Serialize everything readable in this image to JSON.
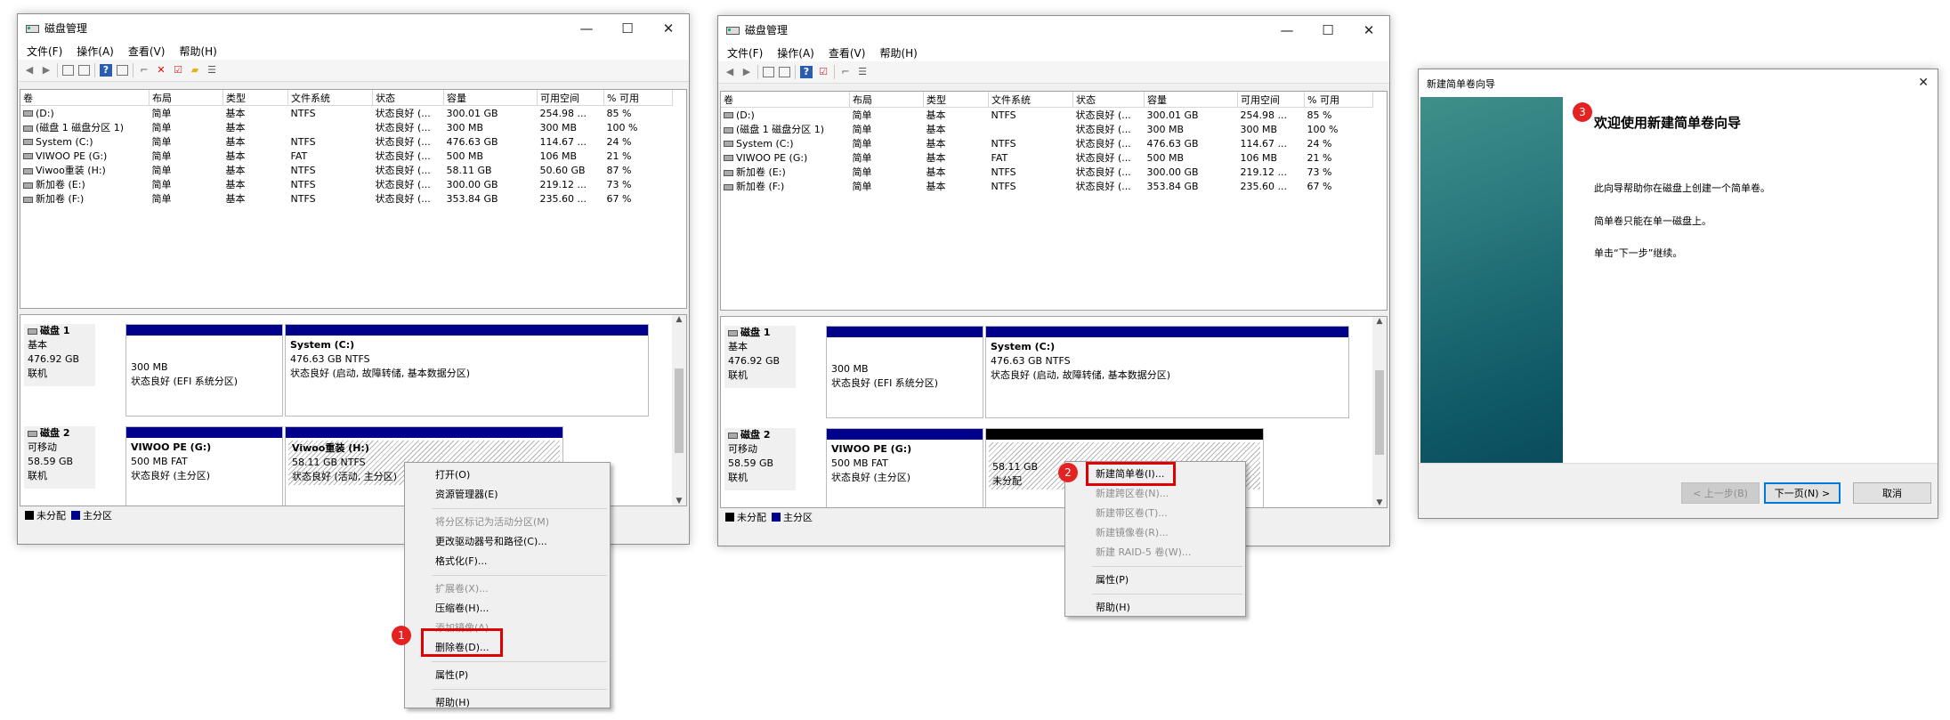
{
  "app": {
    "title": "磁盘管理",
    "menu": [
      "文件(F)",
      "操作(A)",
      "查看(V)",
      "帮助(H)"
    ],
    "window_buttons": {
      "minimize": "—",
      "maximize": "☐",
      "close": "✕"
    }
  },
  "columns": [
    "卷",
    "布局",
    "类型",
    "文件系统",
    "状态",
    "容量",
    "可用空间",
    "% 可用"
  ],
  "volumes_left": [
    [
      "(D:)",
      "简单",
      "基本",
      "NTFS",
      "状态良好 (...",
      "300.01 GB",
      "254.98 ...",
      "85 %"
    ],
    [
      "(磁盘 1 磁盘分区 1)",
      "简单",
      "基本",
      "",
      "状态良好 (...",
      "300 MB",
      "300 MB",
      "100 %"
    ],
    [
      "System (C:)",
      "简单",
      "基本",
      "NTFS",
      "状态良好 (...",
      "476.63 GB",
      "114.67 ...",
      "24 %"
    ],
    [
      "VIWOO PE (G:)",
      "简单",
      "基本",
      "FAT",
      "状态良好 (...",
      "500 MB",
      "106 MB",
      "21 %"
    ],
    [
      "Viwoo重装 (H:)",
      "简单",
      "基本",
      "NTFS",
      "状态良好 (...",
      "58.11 GB",
      "50.60 GB",
      "87 %"
    ],
    [
      "新加卷 (E:)",
      "简单",
      "基本",
      "NTFS",
      "状态良好 (...",
      "300.00 GB",
      "219.12 ...",
      "73 %"
    ],
    [
      "新加卷 (F:)",
      "简单",
      "基本",
      "NTFS",
      "状态良好 (...",
      "353.84 GB",
      "235.60 ...",
      "67 %"
    ]
  ],
  "volumes_right": [
    [
      "(D:)",
      "简单",
      "基本",
      "NTFS",
      "状态良好 (...",
      "300.01 GB",
      "254.98 ...",
      "85 %"
    ],
    [
      "(磁盘 1 磁盘分区 1)",
      "简单",
      "基本",
      "",
      "状态良好 (...",
      "300 MB",
      "300 MB",
      "100 %"
    ],
    [
      "System (C:)",
      "简单",
      "基本",
      "NTFS",
      "状态良好 (...",
      "476.63 GB",
      "114.67 ...",
      "24 %"
    ],
    [
      "VIWOO PE (G:)",
      "简单",
      "基本",
      "FAT",
      "状态良好 (...",
      "500 MB",
      "106 MB",
      "21 %"
    ],
    [
      "新加卷 (E:)",
      "简单",
      "基本",
      "NTFS",
      "状态良好 (...",
      "300.00 GB",
      "219.12 ...",
      "73 %"
    ],
    [
      "新加卷 (F:)",
      "简单",
      "基本",
      "NTFS",
      "状态良好 (...",
      "353.84 GB",
      "235.60 ...",
      "67 %"
    ]
  ],
  "disk1": {
    "name": "磁盘 1",
    "type": "基本",
    "size": "476.92 GB",
    "status": "联机",
    "p1": {
      "size": "300 MB",
      "status": "状态良好 (EFI 系统分区)"
    },
    "p2": {
      "name": "System  (C:)",
      "size": "476.63 GB NTFS",
      "status": "状态良好 (启动, 故障转储, 基本数据分区)"
    }
  },
  "disk2_left": {
    "name": "磁盘 2",
    "type": "可移动",
    "size": "58.59 GB",
    "status": "联机",
    "p1": {
      "name": "VIWOO PE  (G:)",
      "size": "500 MB FAT",
      "status": "状态良好 (主分区)"
    },
    "p2": {
      "name": "Viwoo重装  (H:)",
      "size": "58.11 GB NTFS",
      "status": "状态良好 (活动, 主分区)"
    }
  },
  "disk2_right": {
    "name": "磁盘 2",
    "type": "可移动",
    "size": "58.59 GB",
    "status": "联机",
    "p1": {
      "name": "VIWOO PE  (G:)",
      "size": "500 MB FAT",
      "status": "状态良好 (主分区)"
    },
    "p2": {
      "size": "58.11 GB",
      "status": "未分配"
    }
  },
  "legend": {
    "unallocated": "未分配",
    "primary": "主分区"
  },
  "colors": {
    "primary": "#00008b",
    "unallocated": "#000000",
    "highlight": "#e00000"
  },
  "context_menu_1": [
    {
      "label": "打开(O)",
      "enabled": true
    },
    {
      "label": "资源管理器(E)",
      "enabled": true
    },
    {
      "sep": true
    },
    {
      "label": "将分区标记为活动分区(M)",
      "enabled": false
    },
    {
      "label": "更改驱动器号和路径(C)...",
      "enabled": true
    },
    {
      "label": "格式化(F)...",
      "enabled": true
    },
    {
      "sep": true
    },
    {
      "label": "扩展卷(X)...",
      "enabled": false
    },
    {
      "label": "压缩卷(H)...",
      "enabled": true
    },
    {
      "label": "添加镜像(A)...",
      "enabled": false
    },
    {
      "label": "删除卷(D)...",
      "enabled": true,
      "highlighted": true
    },
    {
      "sep": true
    },
    {
      "label": "属性(P)",
      "enabled": true
    },
    {
      "sep": true
    },
    {
      "label": "帮助(H)",
      "enabled": true
    }
  ],
  "context_menu_2": [
    {
      "label": "新建简单卷(I)...",
      "enabled": true,
      "highlighted": true
    },
    {
      "label": "新建跨区卷(N)...",
      "enabled": false
    },
    {
      "label": "新建带区卷(T)...",
      "enabled": false
    },
    {
      "label": "新建镜像卷(R)...",
      "enabled": false
    },
    {
      "label": "新建 RAID-5 卷(W)...",
      "enabled": false
    },
    {
      "sep": true
    },
    {
      "label": "属性(P)",
      "enabled": true
    },
    {
      "sep": true
    },
    {
      "label": "帮助(H)",
      "enabled": true
    }
  ],
  "badges": {
    "b1": "1",
    "b2": "2",
    "b3": "3"
  },
  "wizard": {
    "title": "新建简单卷向导",
    "close": "✕",
    "heading": "欢迎使用新建简单卷向导",
    "lines": [
      "此向导帮助你在磁盘上创建一个简单卷。",
      "简单卷只能在单一磁盘上。",
      "单击“下一步”继续。"
    ],
    "back": "< 上一步(B)",
    "next": "下一页(N) >",
    "cancel": "取消"
  }
}
